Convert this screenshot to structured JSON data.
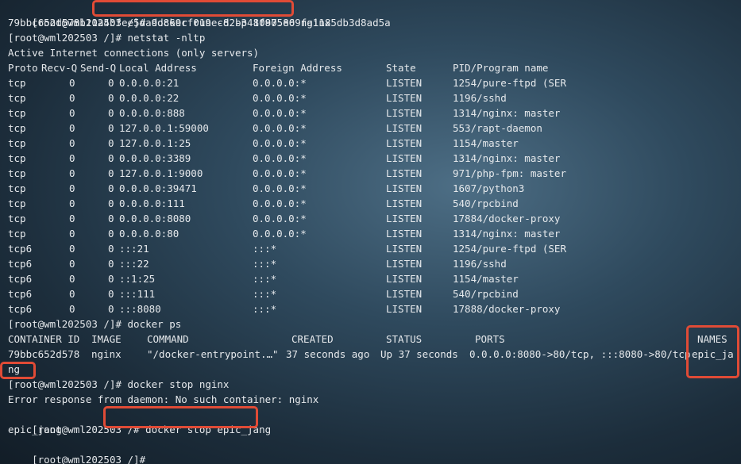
{
  "terminal": {
    "prompt": "[root@wml202503 /]#",
    "cmd_run": {
      "prompt_prefix": "[root@wml202503 ",
      "highlighted": "/]# docker run -d -p 8080:80 nginx"
    },
    "container_hash": "79bbc652d578b11a4bfee5da9d869cf019ec82b341f975e69fa1185db3d8ad5a",
    "cmd_netstat": "[root@wml202503 /]# netstat -nltp",
    "netstat_title": "Active Internet connections (only servers)",
    "netstat_headers": [
      "Proto",
      "Recv-Q",
      "Send-Q",
      "Local Address",
      "Foreign Address",
      "State",
      "PID/Program name"
    ],
    "netstat_rows": [
      [
        "tcp",
        "0",
        "0",
        "0.0.0.0:21",
        "0.0.0.0:*",
        "LISTEN",
        "1254/pure-ftpd (SER"
      ],
      [
        "tcp",
        "0",
        "0",
        "0.0.0.0:22",
        "0.0.0.0:*",
        "LISTEN",
        "1196/sshd"
      ],
      [
        "tcp",
        "0",
        "0",
        "0.0.0.0:888",
        "0.0.0.0:*",
        "LISTEN",
        "1314/nginx: master"
      ],
      [
        "tcp",
        "0",
        "0",
        "127.0.0.1:59000",
        "0.0.0.0:*",
        "LISTEN",
        "553/rapt-daemon"
      ],
      [
        "tcp",
        "0",
        "0",
        "127.0.0.1:25",
        "0.0.0.0:*",
        "LISTEN",
        "1154/master"
      ],
      [
        "tcp",
        "0",
        "0",
        "0.0.0.0:3389",
        "0.0.0.0:*",
        "LISTEN",
        "1314/nginx: master"
      ],
      [
        "tcp",
        "0",
        "0",
        "127.0.0.1:9000",
        "0.0.0.0:*",
        "LISTEN",
        "971/php-fpm: master"
      ],
      [
        "tcp",
        "0",
        "0",
        "0.0.0.0:39471",
        "0.0.0.0:*",
        "LISTEN",
        "1607/python3"
      ],
      [
        "tcp",
        "0",
        "0",
        "0.0.0.0:111",
        "0.0.0.0:*",
        "LISTEN",
        "540/rpcbind"
      ],
      [
        "tcp",
        "0",
        "0",
        "0.0.0.0:8080",
        "0.0.0.0:*",
        "LISTEN",
        "17884/docker-proxy"
      ],
      [
        "tcp",
        "0",
        "0",
        "0.0.0.0:80",
        "0.0.0.0:*",
        "LISTEN",
        "1314/nginx: master"
      ],
      [
        "tcp6",
        "0",
        "0",
        ":::21",
        ":::*",
        "LISTEN",
        "1254/pure-ftpd (SER"
      ],
      [
        "tcp6",
        "0",
        "0",
        ":::22",
        ":::*",
        "LISTEN",
        "1196/sshd"
      ],
      [
        "tcp6",
        "0",
        "0",
        "::1:25",
        ":::*",
        "LISTEN",
        "1154/master"
      ],
      [
        "tcp6",
        "0",
        "0",
        ":::111",
        ":::*",
        "LISTEN",
        "540/rpcbind"
      ],
      [
        "tcp6",
        "0",
        "0",
        ":::8080",
        ":::*",
        "LISTEN",
        "17888/docker-proxy"
      ]
    ],
    "cmd_ps": "[root@wml202503 /]# docker ps",
    "ps_headers": {
      "container_id": "CONTAINER ID",
      "image": "IMAGE",
      "command": "COMMAND",
      "created": "CREATED",
      "status": "STATUS",
      "ports": "PORTS",
      "names": "NAMES"
    },
    "ps_row": {
      "container_id": "79bbc652d578",
      "image": "nginx",
      "command": "\"/docker-entrypoint.…\"",
      "created": "37 seconds ago",
      "status": "Up 37 seconds",
      "ports": "0.0.0.0:8080->80/tcp, :::8080->80/tcp",
      "names_part1": "epic_ja",
      "names_part2": "ng"
    },
    "cmd_stop_nginx": "[root@wml202503 /]# docker stop nginx",
    "error_line": "Error response from daemon: No such container: nginx",
    "cmd_stop_epic": {
      "prompt_prefix": "[root@wml202503 /",
      "highlighted": "# docker stop epic_jang"
    },
    "stop_output": "epic_jang",
    "final_prompt": "[root@wml202503 /]#"
  },
  "colors": {
    "highlight": "#e04b36",
    "text": "#e6e9ec"
  }
}
